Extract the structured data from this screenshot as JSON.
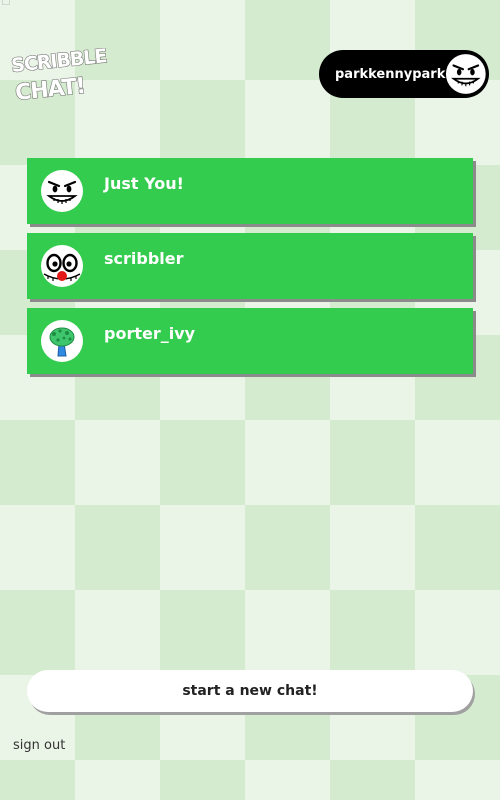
{
  "app": {
    "logo_line1": "SCRIBBLE",
    "logo_line2": "CHAT!"
  },
  "user": {
    "username": "parkkennypark",
    "avatar_icon": "grinning-face-avatar-icon"
  },
  "chats": [
    {
      "name": "Just You!",
      "avatar_icon": "grinning-face-avatar-icon"
    },
    {
      "name": "scribbler",
      "avatar_icon": "clown-face-avatar-icon"
    },
    {
      "name": "porter_ivy",
      "avatar_icon": "tree-avatar-icon"
    }
  ],
  "actions": {
    "new_chat_label": "start a new chat!",
    "sign_out_label": "sign out"
  },
  "colors": {
    "chat_item_bg": "#33cc4e",
    "checker_light": "#eaf4e7",
    "checker_dark": "#d5ebcf",
    "user_pill_bg": "#000000"
  }
}
